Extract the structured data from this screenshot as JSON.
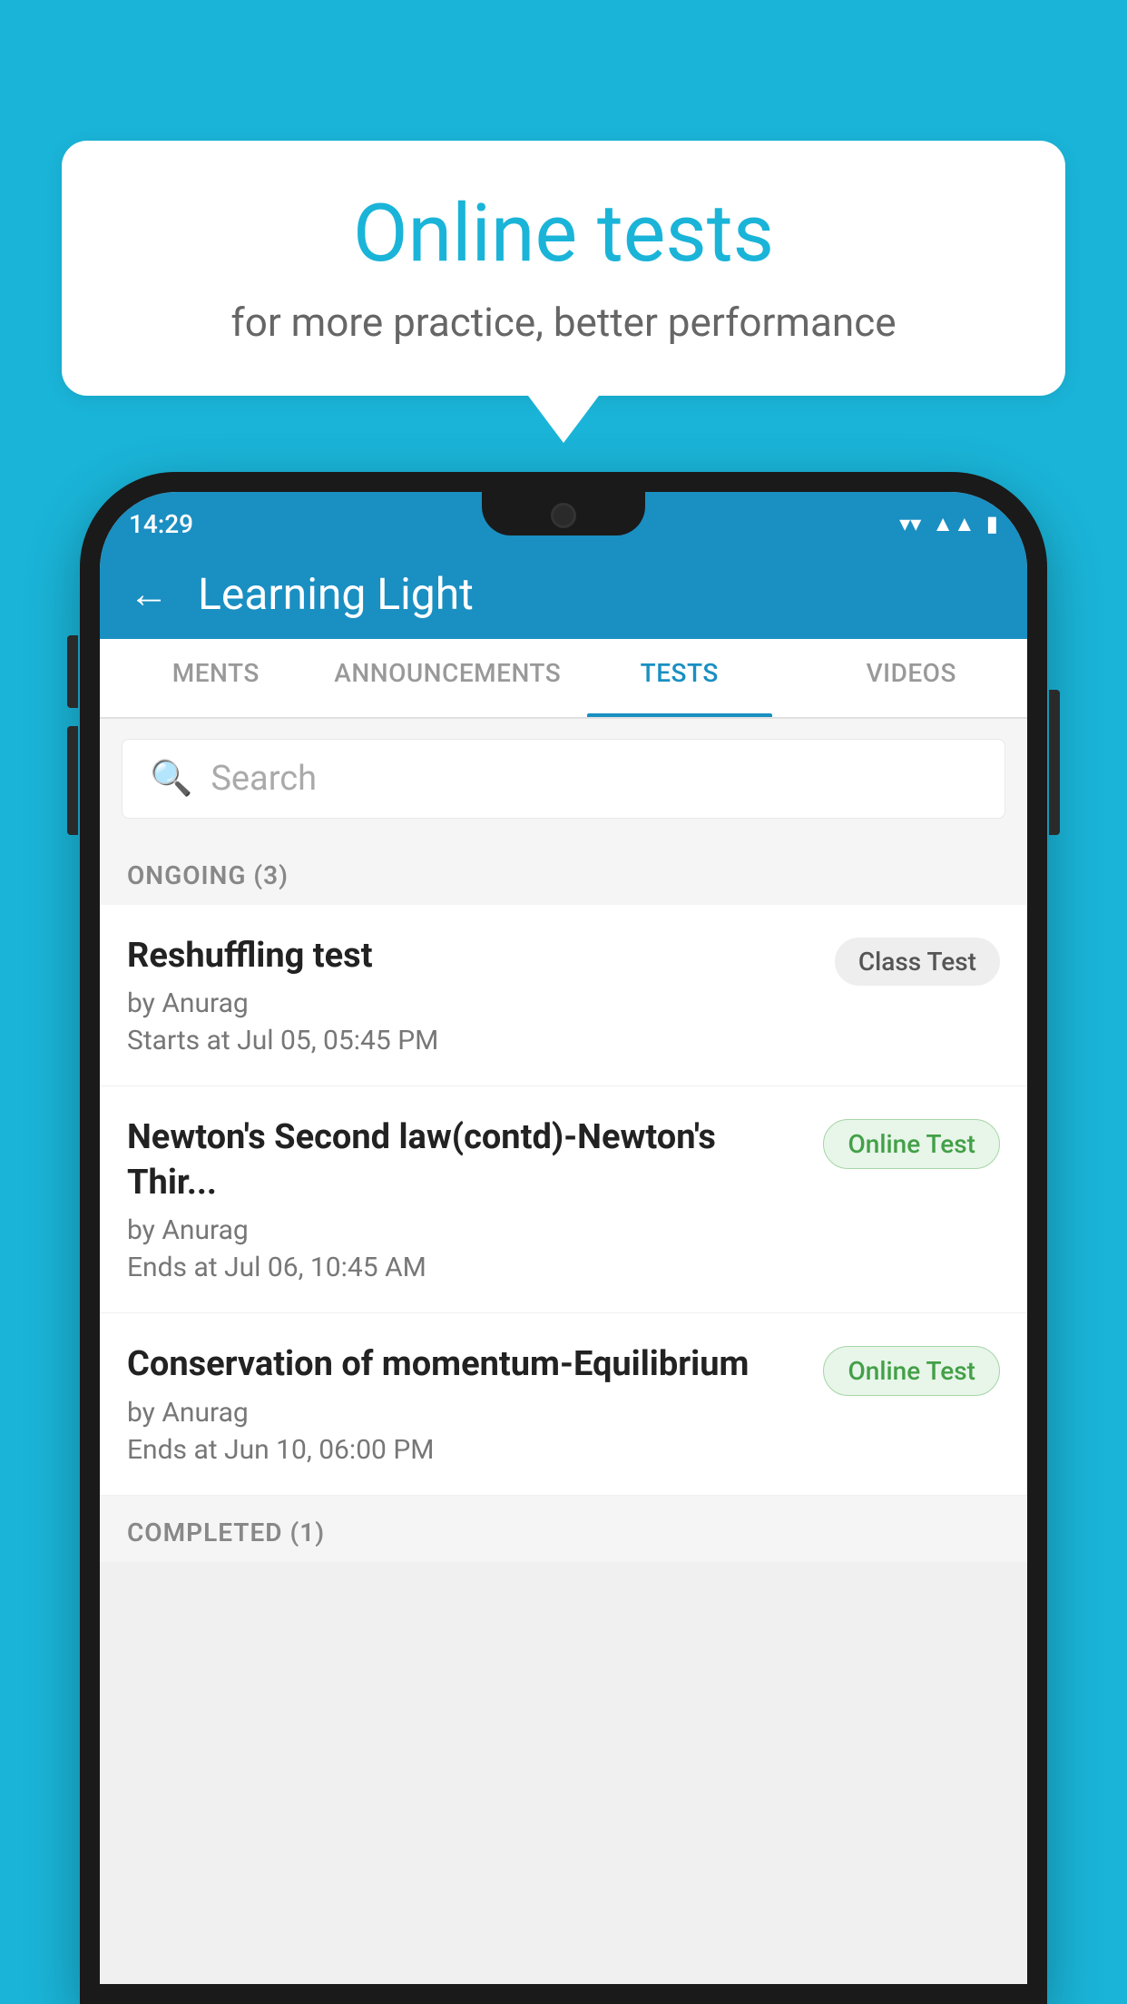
{
  "background_color": "#1ab4d8",
  "speech_bubble": {
    "title": "Online tests",
    "subtitle": "for more practice, better performance"
  },
  "status_bar": {
    "time": "14:29",
    "wifi_icon": "▼",
    "signal_icon": "▲",
    "battery_icon": "▮"
  },
  "app_bar": {
    "back_label": "←",
    "title": "Learning Light"
  },
  "tabs": [
    {
      "label": "MENTS",
      "active": false
    },
    {
      "label": "ANNOUNCEMENTS",
      "active": false
    },
    {
      "label": "TESTS",
      "active": true
    },
    {
      "label": "VIDEOS",
      "active": false
    }
  ],
  "search": {
    "placeholder": "Search"
  },
  "sections": [
    {
      "header": "ONGOING (3)",
      "items": [
        {
          "name": "Reshuffling test",
          "author": "by Anurag",
          "date": "Starts at  Jul 05, 05:45 PM",
          "badge": "Class Test",
          "badge_type": "class"
        },
        {
          "name": "Newton's Second law(contd)-Newton's Thir...",
          "author": "by Anurag",
          "date": "Ends at  Jul 06, 10:45 AM",
          "badge": "Online Test",
          "badge_type": "online"
        },
        {
          "name": "Conservation of momentum-Equilibrium",
          "author": "by Anurag",
          "date": "Ends at  Jun 10, 06:00 PM",
          "badge": "Online Test",
          "badge_type": "online"
        }
      ]
    }
  ],
  "completed_header": "COMPLETED (1)"
}
